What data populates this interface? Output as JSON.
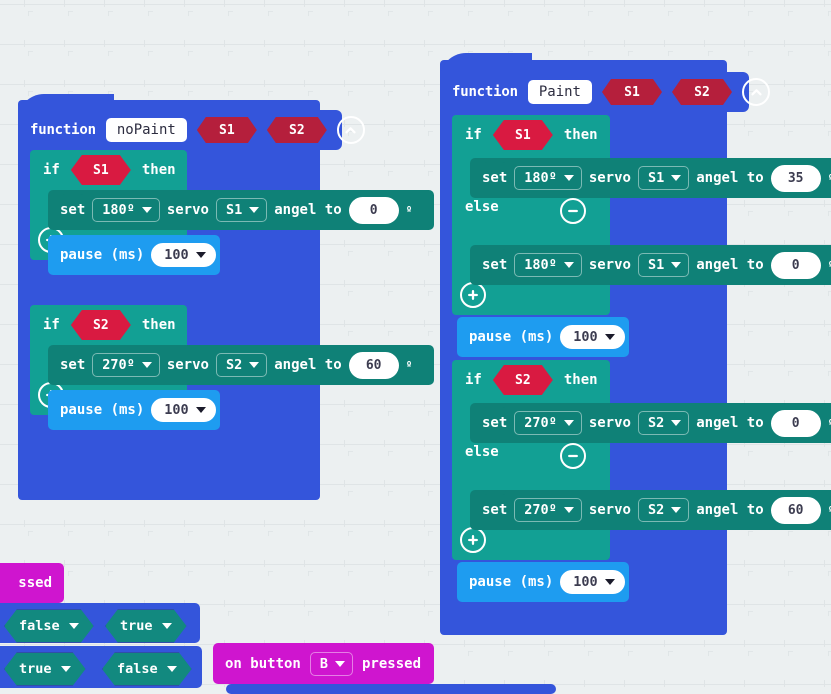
{
  "app": {
    "name": "MakeCode Blocks Workspace",
    "canvas_background": "#ecf0f1",
    "grid_color": "#dfe4e6",
    "grid_spacing": 40
  },
  "palette": {
    "function_blue": "#3455db",
    "logic_teal": "#12a094",
    "servo_teal": "#0f8177",
    "pause_blue": "#1e9cf0",
    "arg_dark_red": "#b51f3c",
    "bool_crimson": "#d91a41",
    "input_magenta": "#cf15cf",
    "field_white": "#ffffff"
  },
  "labels": {
    "function": "function",
    "if": "if",
    "then": "then",
    "else": "else",
    "set": "set",
    "servo": "servo",
    "angel_to": "angel to",
    "degree": "º",
    "pause_ms": "pause (ms)",
    "on_button": "on button",
    "pressed": "pressed"
  },
  "icons": {
    "collapse": "chevron-up-circle-icon",
    "expand_row": "plus-circle-icon",
    "remove_row": "minus-circle-icon",
    "dropdown": "caret-down-icon"
  },
  "functions": [
    {
      "id": "noPaint",
      "name": "noPaint",
      "args": [
        "S1",
        "S2"
      ],
      "collapse_label": "⌃",
      "statements": [
        {
          "kind": "if",
          "condition": "S1",
          "has_else": false,
          "then_body": [
            {
              "kind": "servo",
              "mode": "180º",
              "servo": "S1",
              "angle": "0"
            },
            {
              "kind": "pause",
              "value": "100"
            }
          ]
        },
        {
          "kind": "if",
          "condition": "S2",
          "has_else": false,
          "then_body": [
            {
              "kind": "servo",
              "mode": "270º",
              "servo": "S2",
              "angle": "60"
            },
            {
              "kind": "pause",
              "value": "100"
            }
          ]
        }
      ]
    },
    {
      "id": "Paint",
      "name": "Paint",
      "args": [
        "S1",
        "S2"
      ],
      "collapse_label": "⌃",
      "statements": [
        {
          "kind": "if",
          "condition": "S1",
          "has_else": true,
          "then_body": [
            {
              "kind": "servo",
              "mode": "180º",
              "servo": "S1",
              "angle": "35"
            }
          ],
          "else_body": [
            {
              "kind": "servo",
              "mode": "180º",
              "servo": "S1",
              "angle": "0"
            }
          ]
        },
        {
          "kind": "pause",
          "value": "100"
        },
        {
          "kind": "if",
          "condition": "S2",
          "has_else": true,
          "then_body": [
            {
              "kind": "servo",
              "mode": "270º",
              "servo": "S2",
              "angle": "0"
            }
          ],
          "else_body": [
            {
              "kind": "servo",
              "mode": "270º",
              "servo": "S2",
              "angle": "60"
            }
          ]
        },
        {
          "kind": "pause",
          "value": "100"
        }
      ]
    }
  ],
  "offscreen": {
    "left_event_fragment": "ssed",
    "bool_rows": [
      [
        "false",
        "true"
      ],
      [
        "true",
        "false"
      ]
    ],
    "button_event": {
      "prefix": "on button",
      "button": "B",
      "suffix": "pressed"
    }
  }
}
